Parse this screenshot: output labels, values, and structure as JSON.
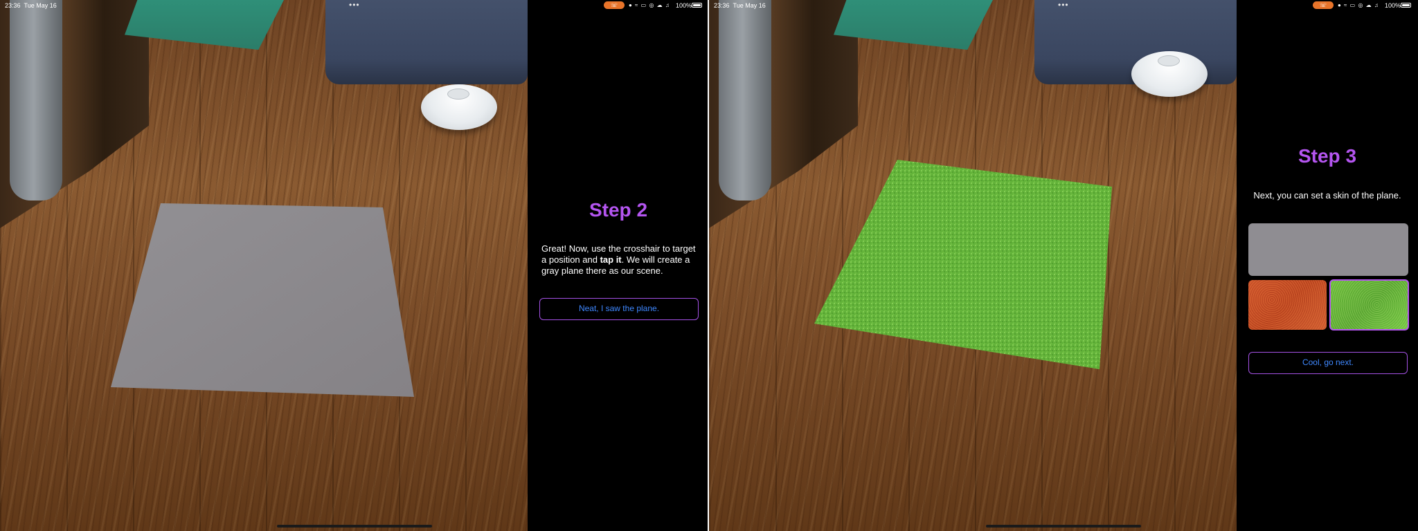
{
  "status_bar": {
    "time": "23:36",
    "date": "Tue May 16",
    "battery": "100%",
    "more_dots": "•••",
    "icons": "● ≈ ▭ ◎ ☁ ♫"
  },
  "left_screen": {
    "step_title": "Step 2",
    "description_before": "Great! Now, use the crosshair to target a position and ",
    "description_bold": "tap it",
    "description_after": ". We will create a gray plane there as our scene.",
    "button_label": "Neat, I saw the plane.",
    "plane_color": "#8c898d"
  },
  "right_screen": {
    "step_title": "Step 3",
    "description": "Next, you can set a skin of the plane.",
    "skins": [
      {
        "name": "Gray",
        "color": "#8f8d92",
        "selected": false
      },
      {
        "name": "Orange",
        "color": "#c9522a",
        "selected": false
      },
      {
        "name": "Grass",
        "color": "#6cbb3c",
        "selected": true
      }
    ],
    "button_label": "Cool, go next."
  },
  "colors": {
    "accent_purple": "#b455f0",
    "button_text_blue": "#3f88ff",
    "status_pill_orange": "#e8742a"
  }
}
